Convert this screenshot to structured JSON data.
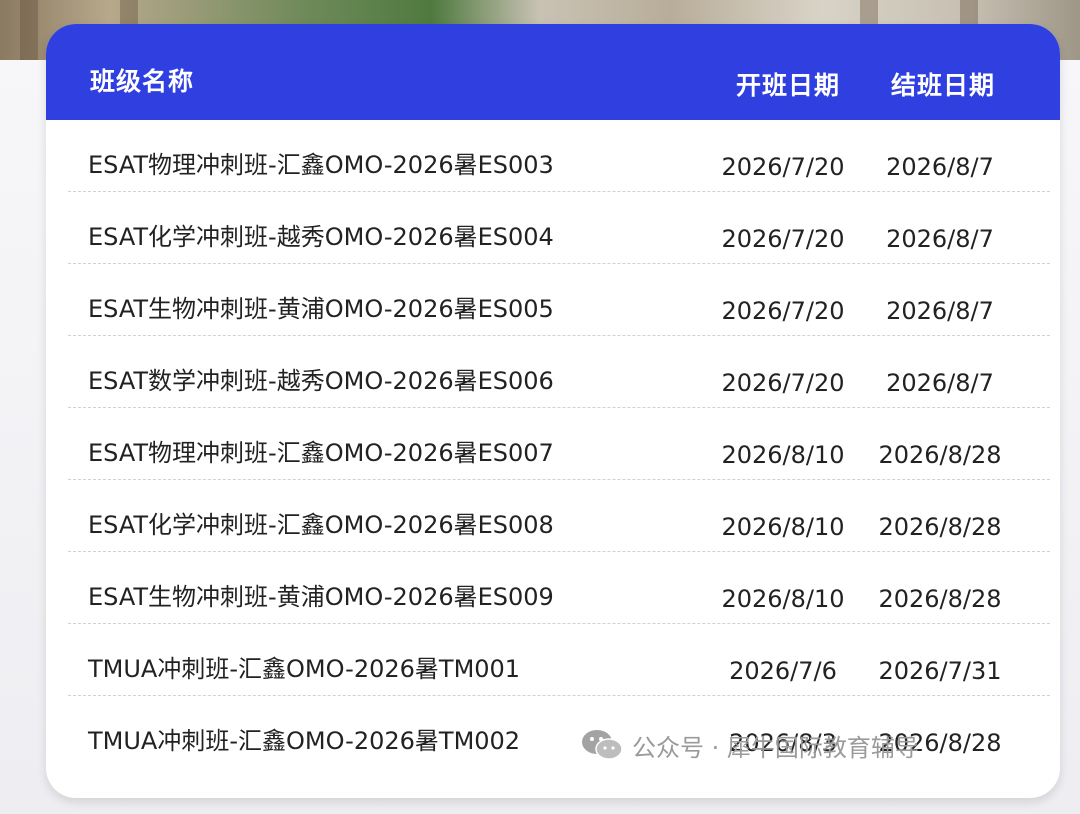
{
  "table": {
    "headers": {
      "name": "班级名称",
      "start": "开班日期",
      "end": "结班日期"
    },
    "rows": [
      {
        "name": "ESAT物理冲刺班-汇鑫OMO-2026暑ES003",
        "start": "2026/7/20",
        "end": "2026/8/7"
      },
      {
        "name": "ESAT化学冲刺班-越秀OMO-2026暑ES004",
        "start": "2026/7/20",
        "end": "2026/8/7"
      },
      {
        "name": "ESAT生物冲刺班-黄浦OMO-2026暑ES005",
        "start": "2026/7/20",
        "end": "2026/8/7"
      },
      {
        "name": "ESAT数学冲刺班-越秀OMO-2026暑ES006",
        "start": "2026/7/20",
        "end": "2026/8/7"
      },
      {
        "name": "ESAT物理冲刺班-汇鑫OMO-2026暑ES007",
        "start": "2026/8/10",
        "end": "2026/8/28"
      },
      {
        "name": "ESAT化学冲刺班-汇鑫OMO-2026暑ES008",
        "start": "2026/8/10",
        "end": "2026/8/28"
      },
      {
        "name": "ESAT生物冲刺班-黄浦OMO-2026暑ES009",
        "start": "2026/8/10",
        "end": "2026/8/28"
      },
      {
        "name": "TMUA冲刺班-汇鑫OMO-2026暑TM001",
        "start": "2026/7/6",
        "end": "2026/7/31"
      },
      {
        "name": "TMUA冲刺班-汇鑫OMO-2026暑TM002",
        "start": "2026/8/3",
        "end": "2026/8/28"
      }
    ]
  },
  "watermark": {
    "icon": "wechat-icon",
    "text": "公众号 · 犀牛国际教育辅导"
  },
  "colors": {
    "header_bg": "#2f3fe0",
    "header_text": "#ffffff",
    "row_text": "#222222",
    "divider": "#c9d3dc"
  }
}
